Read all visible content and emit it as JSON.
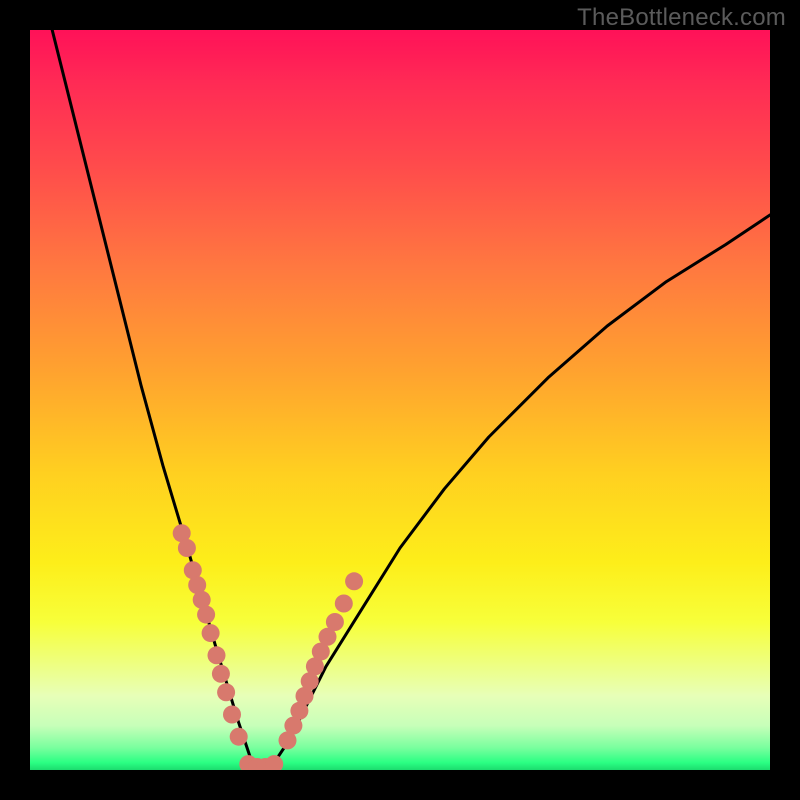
{
  "attribution": "TheBottleneck.com",
  "chart_data": {
    "type": "line",
    "title": "",
    "xlabel": "",
    "ylabel": "",
    "xlim": [
      0,
      100
    ],
    "ylim": [
      0,
      100
    ],
    "grid": false,
    "legend": false,
    "series": [
      {
        "name": "bottleneck-curve",
        "x": [
          3,
          6,
          9,
          12,
          15,
          18,
          21,
          23,
          25,
          26.5,
          28,
          29,
          30,
          31,
          32,
          33,
          35,
          37,
          40,
          45,
          50,
          56,
          62,
          70,
          78,
          86,
          94,
          100
        ],
        "y": [
          100,
          88,
          76,
          64,
          52,
          41,
          31,
          24,
          17,
          12,
          7,
          4,
          1,
          0,
          0,
          1,
          4,
          8,
          14,
          22,
          30,
          38,
          45,
          53,
          60,
          66,
          71,
          75
        ]
      }
    ],
    "markers": [
      {
        "name": "left-branch-points",
        "x": [
          20.5,
          21.2,
          22.0,
          22.6,
          23.2,
          23.8,
          24.4,
          25.2,
          25.8,
          26.5,
          27.3,
          28.2
        ],
        "y": [
          32,
          30,
          27,
          25,
          23,
          21,
          18.5,
          15.5,
          13,
          10.5,
          7.5,
          4.5
        ]
      },
      {
        "name": "valley-floor-points",
        "x": [
          29.5,
          30.7,
          31.8,
          33.0
        ],
        "y": [
          0.8,
          0.4,
          0.4,
          0.8
        ]
      },
      {
        "name": "right-branch-points",
        "x": [
          34.8,
          35.6,
          36.4,
          37.1,
          37.8,
          38.5,
          39.3,
          40.2,
          41.2,
          42.4,
          43.8
        ],
        "y": [
          4,
          6,
          8,
          10,
          12,
          14,
          16,
          18,
          20,
          22.5,
          25.5
        ]
      }
    ],
    "marker_style": {
      "color": "#d8796d",
      "radius_px": 9
    },
    "annotations": []
  }
}
